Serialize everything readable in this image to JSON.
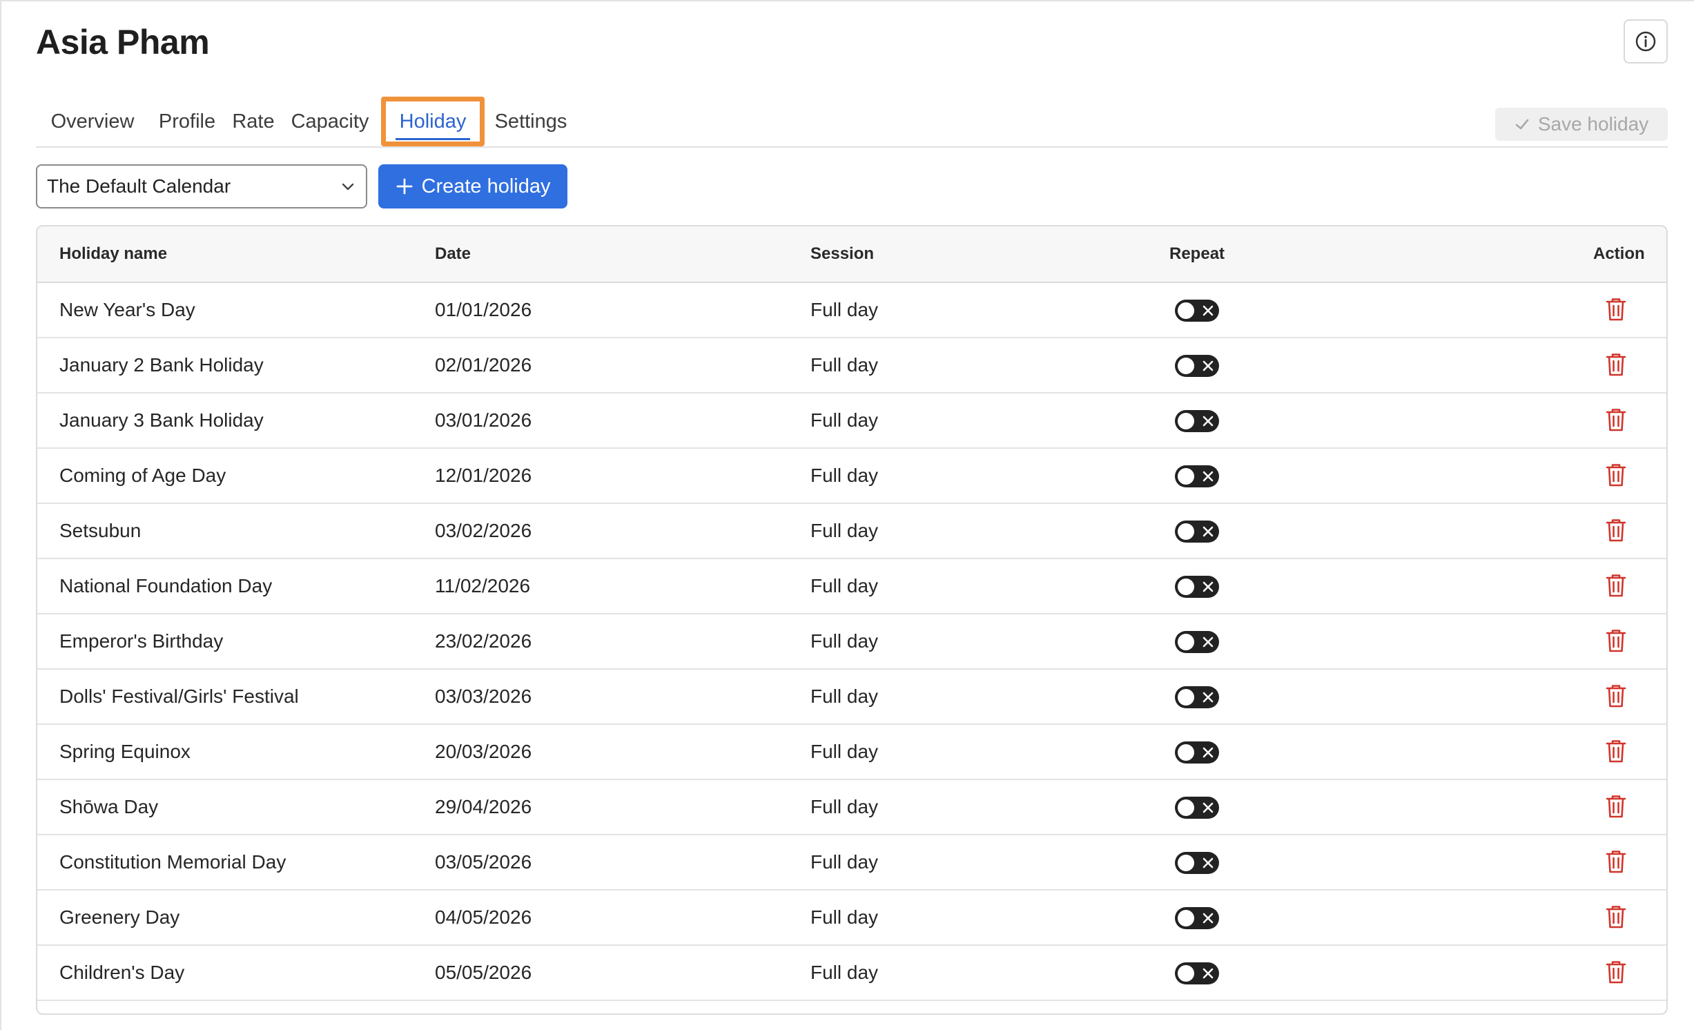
{
  "header": {
    "title": "Asia Pham",
    "info_icon": "info-icon"
  },
  "tabs": [
    {
      "label": "Overview",
      "active": false
    },
    {
      "label": "Profile",
      "active": false
    },
    {
      "label": "Rate",
      "active": false
    },
    {
      "label": "Capacity",
      "active": false
    },
    {
      "label": "Holiday",
      "active": true
    },
    {
      "label": "Settings",
      "active": false
    }
  ],
  "toolbar": {
    "save_label": "Save holiday",
    "calendar_value": "The Default Calendar",
    "create_label": "Create holiday"
  },
  "table": {
    "headers": {
      "name": "Holiday name",
      "date": "Date",
      "session": "Session",
      "repeat": "Repeat",
      "action": "Action"
    },
    "rows": [
      {
        "name": "New Year's Day",
        "date": "01/01/2026",
        "session": "Full day",
        "repeat": false
      },
      {
        "name": "January 2 Bank Holiday",
        "date": "02/01/2026",
        "session": "Full day",
        "repeat": false
      },
      {
        "name": "January 3 Bank Holiday",
        "date": "03/01/2026",
        "session": "Full day",
        "repeat": false
      },
      {
        "name": "Coming of Age Day",
        "date": "12/01/2026",
        "session": "Full day",
        "repeat": false
      },
      {
        "name": "Setsubun",
        "date": "03/02/2026",
        "session": "Full day",
        "repeat": false
      },
      {
        "name": "National Foundation Day",
        "date": "11/02/2026",
        "session": "Full day",
        "repeat": false
      },
      {
        "name": "Emperor's Birthday",
        "date": "23/02/2026",
        "session": "Full day",
        "repeat": false
      },
      {
        "name": "Dolls' Festival/Girls' Festival",
        "date": "03/03/2026",
        "session": "Full day",
        "repeat": false
      },
      {
        "name": "Spring Equinox",
        "date": "20/03/2026",
        "session": "Full day",
        "repeat": false
      },
      {
        "name": "Shōwa Day",
        "date": "29/04/2026",
        "session": "Full day",
        "repeat": false
      },
      {
        "name": "Constitution Memorial Day",
        "date": "03/05/2026",
        "session": "Full day",
        "repeat": false
      },
      {
        "name": "Greenery Day",
        "date": "04/05/2026",
        "session": "Full day",
        "repeat": false
      },
      {
        "name": "Children's Day",
        "date": "05/05/2026",
        "session": "Full day",
        "repeat": false
      }
    ]
  },
  "colors": {
    "accent": "#2f6fe0",
    "active_tab_text": "#2b63d1",
    "active_tab_highlight": "#f0923a",
    "delete": "#d0352b",
    "toggle_off": "#222222"
  }
}
